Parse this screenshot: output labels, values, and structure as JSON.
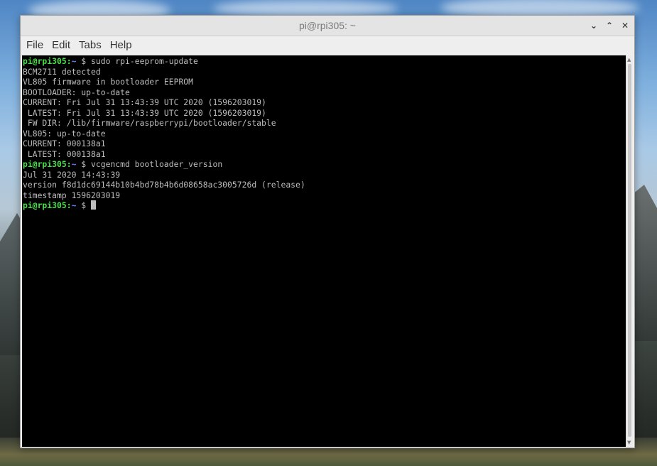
{
  "window": {
    "title": "pi@rpi305: ~",
    "controls": {
      "minimize": "⌄",
      "maximize": "⌃",
      "close": "✕"
    }
  },
  "menubar": {
    "items": [
      "File",
      "Edit",
      "Tabs",
      "Help"
    ]
  },
  "terminal": {
    "prompt": {
      "user": "pi@rpi305:",
      "path": "~",
      "sign": "$"
    },
    "lines": [
      {
        "type": "cmd",
        "text": " sudo rpi-eeprom-update"
      },
      {
        "type": "out",
        "text": "BCM2711 detected"
      },
      {
        "type": "out",
        "text": "VL805 firmware in bootloader EEPROM"
      },
      {
        "type": "out",
        "text": "BOOTLOADER: up-to-date"
      },
      {
        "type": "out",
        "text": "CURRENT: Fri Jul 31 13:43:39 UTC 2020 (1596203019)"
      },
      {
        "type": "out",
        "text": " LATEST: Fri Jul 31 13:43:39 UTC 2020 (1596203019)"
      },
      {
        "type": "out",
        "text": " FW DIR: /lib/firmware/raspberrypi/bootloader/stable"
      },
      {
        "type": "out",
        "text": "VL805: up-to-date"
      },
      {
        "type": "out",
        "text": "CURRENT: 000138a1"
      },
      {
        "type": "out",
        "text": " LATEST: 000138a1"
      },
      {
        "type": "cmd",
        "text": " vcgencmd bootloader_version"
      },
      {
        "type": "out",
        "text": "Jul 31 2020 14:43:39"
      },
      {
        "type": "out",
        "text": "version f8d1dc69144b10b4bd78b4b6d08658ac3005726d (release)"
      },
      {
        "type": "out",
        "text": "timestamp 1596203019"
      },
      {
        "type": "cmd",
        "text": " "
      }
    ]
  },
  "colors": {
    "prompt_user": "#4be04b",
    "prompt_path": "#5f7bff",
    "terminal_bg": "#000000",
    "terminal_fg": "#bdbdbd"
  }
}
